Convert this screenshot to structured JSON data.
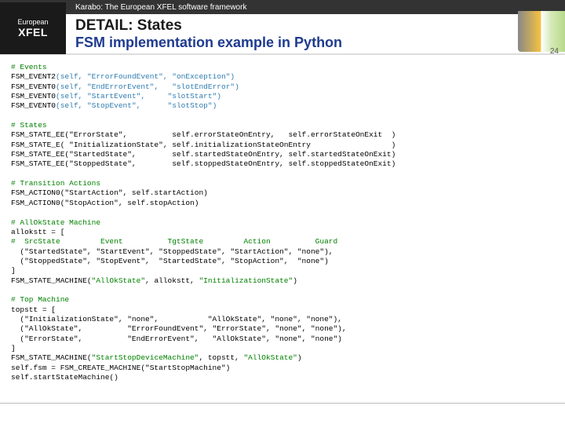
{
  "header": {
    "framework": "Karabo: The European XFEL software framework"
  },
  "logo": {
    "eu": "European",
    "brand": "XFEL"
  },
  "title": {
    "main": "DETAIL: States",
    "sub": "FSM implementation example in Python"
  },
  "slidenum": "24",
  "code": {
    "c1": "# Events",
    "e1a": "FSM_EVENT2",
    "e1b": "(self, ",
    "e1c": "\"ErrorFoundEvent\"",
    "e1d": ", ",
    "e1e": "\"onException\"",
    "e1f": ")",
    "e2a": "FSM_EVENT0",
    "e2b": "(self, ",
    "e2c": "\"EndErrorEvent\"",
    "e2d": ",   ",
    "e2e": "\"slotEndError\"",
    "e2f": ")",
    "e3a": "FSM_EVENT0",
    "e3b": "(self, ",
    "e3c": "\"StartEvent\"",
    "e3d": ",     ",
    "e3e": "\"slotStart\"",
    "e3f": ")",
    "e4a": "FSM_EVENT0",
    "e4b": "(self, ",
    "e4c": "\"StopEvent\"",
    "e4d": ",      ",
    "e4e": "\"slotStop\"",
    "e4f": ")",
    "c2": "# States",
    "s1": "FSM_STATE_EE(\"ErrorState\",          self.errorStateOnEntry,   self.errorStateOnExit  )",
    "s2": "FSM_STATE_E( \"InitializationState\", self.initializationStateOnEntry                  )",
    "s3": "FSM_STATE_EE(\"StartedState\",        self.startedStateOnEntry, self.startedStateOnExit)",
    "s4": "FSM_STATE_EE(\"StoppedState\",        self.stoppedStateOnEntry, self.stoppedStateOnExit)",
    "c3": "# Transition Actions",
    "a1": "FSM_ACTION0(\"StartAction\", self.startAction)",
    "a2": "FSM_ACTION0(\"StopAction\", self.stopAction)",
    "c4": "# AllOkState Machine",
    "ak1": "allokstt = [",
    "ak2": "#  SrcState         Event          TgtState         Action          Guard",
    "ak3": "  (\"StartedState\", \"StartEvent\", \"StoppedState\", \"StartAction\", \"none\"),",
    "ak4": "  (\"StoppedState\", \"StopEvent\",  \"StartedState\", \"StopAction\",  \"none\")",
    "ak5": "]",
    "ak6a": "FSM_STATE_MACHINE(",
    "ak6b": "\"AllOkState\"",
    "ak6c": ", allokstt, ",
    "ak6d": "\"InitializationState\"",
    "ak6e": ")",
    "c5": "# Top Machine",
    "tp1": "topstt = [",
    "tp2": "  (\"InitializationState\", \"none\",           \"AllOkState\", \"none\", \"none\"),",
    "tp3": "  (\"AllOkState\",          \"ErrorFoundEvent\", \"ErrorState\", \"none\", \"none\"),",
    "tp4": "  (\"ErrorState\",          \"EndErrorEvent\",   \"AllOkState\", \"none\", \"none\")",
    "tp5": "]",
    "tp6a": "FSM_STATE_MACHINE(",
    "tp6b": "\"StartStopDeviceMachine\"",
    "tp6c": ", topstt, ",
    "tp6d": "\"AllOkState\"",
    "tp6e": ")",
    "l1": "self.fsm = FSM_CREATE_MACHINE(\"StartStopMachine\")",
    "l2": "self.startStateMachine()"
  }
}
